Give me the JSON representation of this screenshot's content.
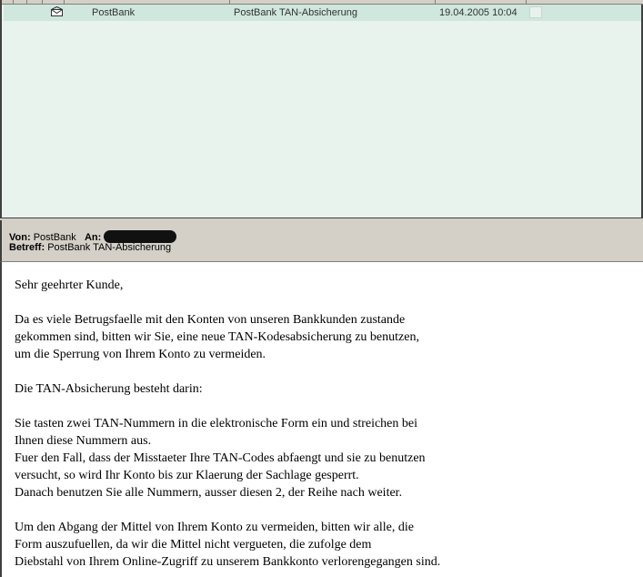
{
  "message_list": {
    "rows": [
      {
        "from": "PostBank",
        "subject": "PostBank TAN-Absicherung",
        "received": "19.04.2005 10:04"
      }
    ]
  },
  "preview": {
    "from_label": "Von:",
    "from_value": "PostBank",
    "to_label": "An:",
    "subject_label": "Betreff:",
    "subject_value": "PostBank TAN-Absicherung",
    "body": "Sehr geehrter Kunde,\n\nDa es viele Betrugsfaelle mit den Konten von unseren Bankkunden zustande\ngekommen sind, bitten wir Sie, eine neue TAN-Kodesabsicherung zu benutzen,\num die Sperrung von Ihrem Konto zu vermeiden.\n\nDie TAN-Absicherung besteht darin:\n\nSie tasten zwei TAN-Nummern in die elektronische Form ein und streichen bei\nIhnen diese Nummern aus.\nFuer den Fall, dass der Misstaeter Ihre TAN-Codes abfaengt und sie zu benutzen\nversucht, so wird Ihr Konto bis zur Klaerung der Sachlage gesperrt.\nDanach benutzen Sie alle Nummern, ausser diesen 2, der Reihe nach weiter.\n\nUm den Abgang der Mittel von Ihrem Konto zu vermeiden, bitten wir alle, die\nForm auszufuellen, da wir die Mittel nicht vergueten, die zufolge dem\nDiebstahl von Ihrem Online-Zugriff zu unserem Bankkonto verlorengegangen sind."
  },
  "icons": {
    "row_icon": "envelope-icon",
    "flag": "flag-cell-icon"
  },
  "colors": {
    "list_background": "#e9f3ee",
    "selected_row": "#cfe7dc",
    "chrome": "#d4d0c8"
  }
}
